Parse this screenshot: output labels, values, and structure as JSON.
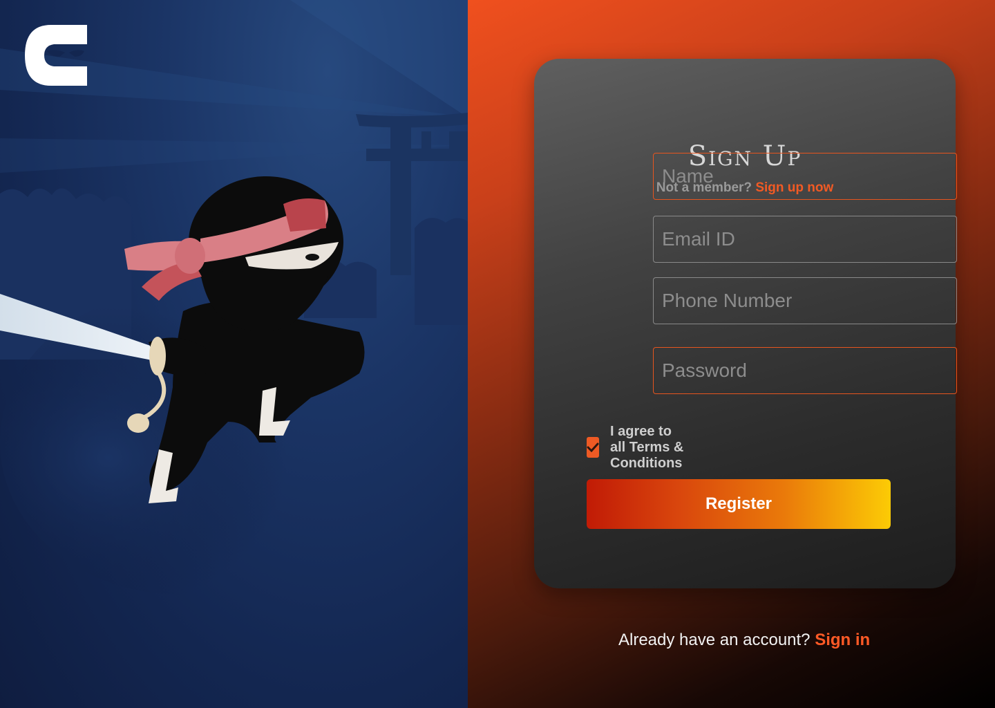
{
  "brand": {
    "logo_icon": "ninja-e-logo-icon"
  },
  "signup": {
    "title": "Sign Up",
    "prompt": "Not a member?",
    "prompt_link": "Sign up now",
    "fields": {
      "name_placeholder": "Name",
      "email_placeholder": "Email ID",
      "phone_placeholder": "Phone Number",
      "password_placeholder": "Password"
    },
    "agree_label": "I agree to all Terms & Conditions",
    "agree_checked": true,
    "register_label": "Register"
  },
  "footer": {
    "prompt": "Already have an account?",
    "link": "Sign in"
  },
  "colors": {
    "accent": "#f25a24",
    "left_panel": "#152a57",
    "card": "#3a3a3a",
    "button_start": "#c11b06",
    "button_end": "#fccb05"
  }
}
